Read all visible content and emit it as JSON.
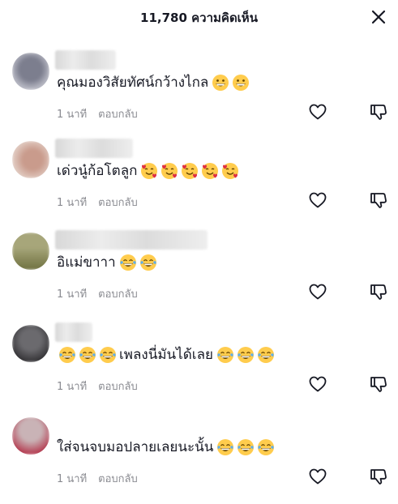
{
  "header": {
    "title": "11,780 ความคิดเห็น",
    "close_icon": "close-icon"
  },
  "comments": [
    {
      "text": "คุณมองวิสัยทัศน์กว้างไกล",
      "emoji": "grin-face",
      "emoji_count": 2,
      "time": "1 นาที",
      "reply": "ตอบกลับ",
      "avatar_color": "#8d8f9e"
    },
    {
      "text": "เด่วนู๋ก้อโตลูก",
      "emoji": "smiling-face-with-hearts",
      "emoji_count": 5,
      "time": "1 นาที",
      "reply": "ตอบกลับ",
      "avatar_color": "#cfa79a"
    },
    {
      "text": "อิแม่ขาาา",
      "emoji": "tears-of-joy-face",
      "emoji_count": 2,
      "time": "1 นาที",
      "reply": "ตอบกลับ",
      "avatar_color": "#8a8a5a"
    },
    {
      "text": "เพลงนี่มันได้เลย",
      "emoji": "tears-of-joy-face",
      "emoji_count": 3,
      "emoji_before": 3,
      "time": "1 นาที",
      "reply": "ตอบกลับ",
      "avatar_color": "#555458"
    },
    {
      "text": "ใส่จนจบมอปลายเลยนะนั้น",
      "emoji": "tears-of-joy-face",
      "emoji_count": 3,
      "time": "1 นาที",
      "reply": "ตอบกลับ",
      "avatar_color": "#c44a5b"
    }
  ]
}
